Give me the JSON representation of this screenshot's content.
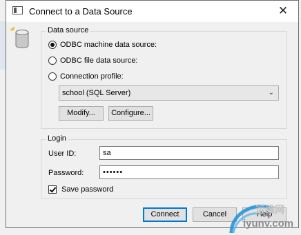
{
  "window": {
    "title": "Connect to a Data Source",
    "close_glyph": "✕"
  },
  "data_source": {
    "group_label": "Data source",
    "options": [
      {
        "label": "ODBC machine data source:",
        "checked": true
      },
      {
        "label": "ODBC file data source:",
        "checked": false
      },
      {
        "label": "Connection profile:",
        "checked": false
      }
    ],
    "profile_select": {
      "value": "school (SQL Server)",
      "arrow_glyph": "⌄"
    },
    "modify_label": "Modify...",
    "configure_label": "Configure..."
  },
  "login": {
    "group_label": "Login",
    "user_id_label": "User ID:",
    "user_id_value": "sa",
    "password_label": "Password:",
    "password_value": "••••••",
    "save_password_label": "Save password",
    "save_password_checked": true
  },
  "buttons": {
    "connect": "Connect",
    "cancel": "Cancel",
    "help": "Help"
  },
  "watermark": {
    "text_cn": "运维网",
    "text_url": "iyunv.com"
  },
  "colors": {
    "accent": "#0078d7",
    "watermark_ring": "#1e8fd6"
  }
}
